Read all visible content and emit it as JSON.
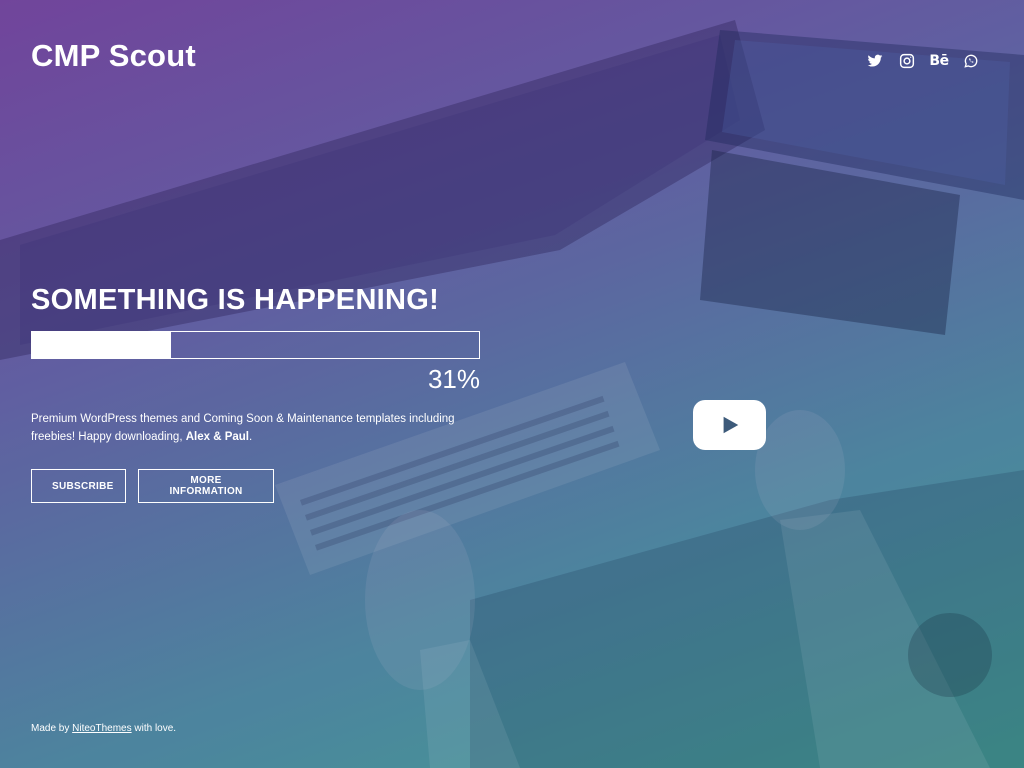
{
  "site": {
    "title": "CMP Scout"
  },
  "social": [
    {
      "icon": "twitter-icon"
    },
    {
      "icon": "instagram-icon"
    },
    {
      "icon": "behance-icon",
      "text": "Bē"
    },
    {
      "icon": "whatsapp-icon"
    }
  ],
  "hero": {
    "headline": "SOMETHING IS HAPPENING!",
    "progress_percent": 31,
    "progress_label": "31%",
    "description_text": "Premium WordPress themes and Coming Soon & Maintenance templates including freebies! Happy downloading, ",
    "description_strong": "Alex & Paul",
    "description_end": "."
  },
  "buttons": {
    "subscribe_label": "SUBSCRIBE",
    "more_label": "MORE INFORMATION"
  },
  "video": {
    "play_icon": "play-icon"
  },
  "footer": {
    "prefix": "Made by ",
    "link_text": "NiteoThemes",
    "suffix": " with love."
  },
  "colors": {
    "gradient_start": "#6d3f98",
    "gradient_end": "#3e9b8e",
    "play_icon": "#3d5a7a"
  }
}
